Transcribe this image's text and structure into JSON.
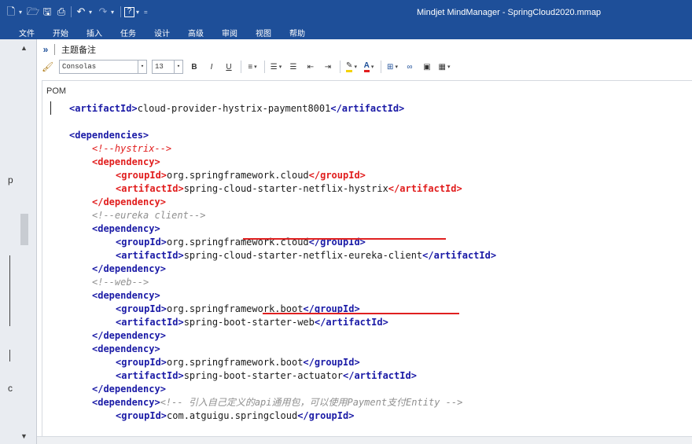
{
  "window": {
    "title": "Mindjet MindManager - SpringCloud2020.mmap"
  },
  "menu": [
    "文件",
    "开始",
    "插入",
    "任务",
    "设计",
    "高级",
    "审阅",
    "视图",
    "帮助"
  ],
  "notes_panel": {
    "expand_glyph": "»",
    "title": "主题备注"
  },
  "format_toolbar": {
    "font": "Consolas",
    "size": "13",
    "bold": "B",
    "italic": "I",
    "underline": "U"
  },
  "left_strip_marks": [
    "p",
    "c"
  ],
  "editor": {
    "doc_label": "POM",
    "code": {
      "artifact_open": "<artifactId>",
      "artifact_close": "</artifactId>",
      "group_open": "<groupId>",
      "group_close": "</groupId>",
      "dependency_open": "<dependency>",
      "dependency_close": "</dependency>",
      "dependencies_open": "<dependencies>",
      "artifact_id_value": "cloud-provider-hystrix-payment8001",
      "comment_hystrix": "<!--hystrix-->",
      "comment_eureka": "<!--eureka client-->",
      "comment_web": "<!--web-->",
      "comment_payment": "<!-- 引入自己定义的api通用包，可以使用Payment支付Entity -->",
      "group_springcloud": "org.springframework.cloud",
      "group_springboot": "org.springframework.boot",
      "group_atguigu": "com.atguigu.springcloud",
      "artifact_hystrix": "spring-cloud-starter-netflix-hystrix",
      "artifact_eureka": "spring-cloud-starter-netflix-eureka-client",
      "artifact_web": "spring-boot-starter-web",
      "artifact_actuator": "spring-boot-starter-actuator"
    }
  },
  "colors": {
    "titlebar": "#1e4f99",
    "tag": "#1a1aa6",
    "highlight_tag": "#e11d1d",
    "comment": "#8f8f8f",
    "annotation_underline": "#e02020"
  }
}
